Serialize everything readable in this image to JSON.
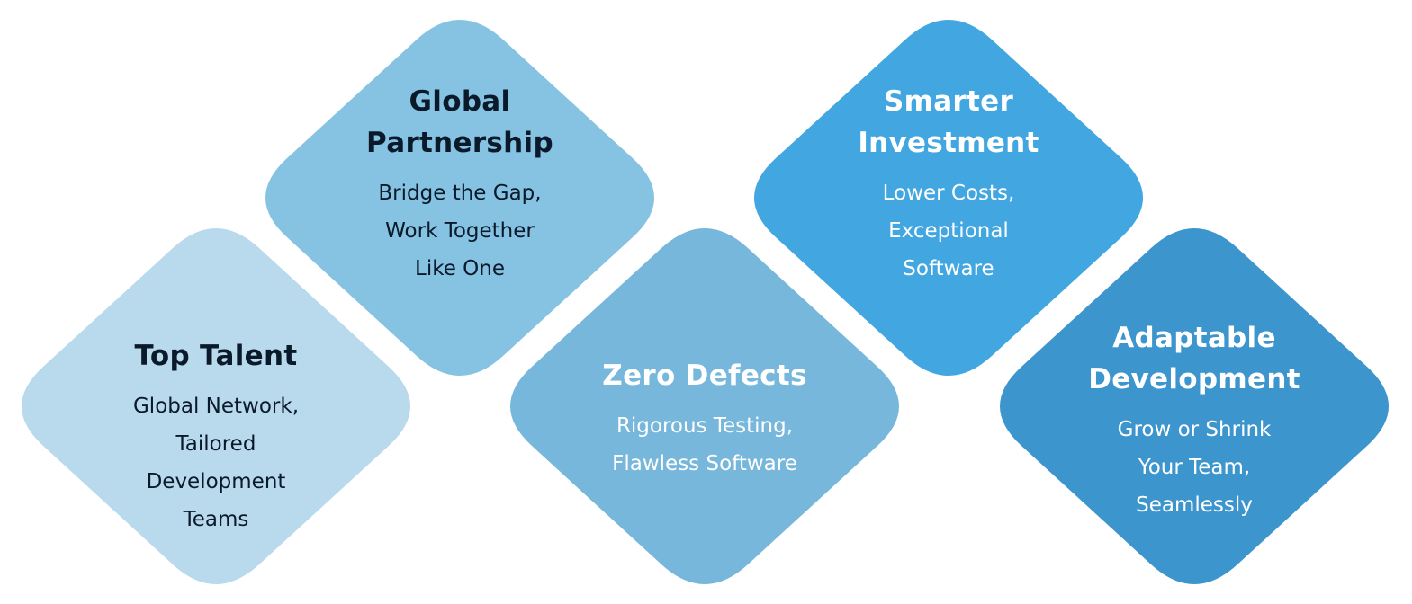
{
  "diamonds": [
    {
      "title": "Top Talent",
      "description_lines": [
        "Global Network,",
        "Tailored",
        "Development",
        "Teams"
      ],
      "fill": "#b9d9ec",
      "text_color": "dark"
    },
    {
      "title": "Global Partnership",
      "title_lines": [
        "Global",
        "Partnership"
      ],
      "description_lines": [
        "Bridge the Gap,",
        "Work Together",
        "Like One"
      ],
      "fill": "#86c3e2",
      "text_color": "dark"
    },
    {
      "title": "Zero Defects",
      "description_lines": [
        "Rigorous Testing,",
        "Flawless Software"
      ],
      "fill": "#76b7db",
      "text_color": "light"
    },
    {
      "title": "Smarter Investment",
      "title_lines": [
        "Smarter",
        "Investment"
      ],
      "description_lines": [
        "Lower Costs,",
        "Exceptional",
        "Software"
      ],
      "fill": "#42a6e0",
      "text_color": "light"
    },
    {
      "title": "Adaptable Development",
      "title_lines": [
        "Adaptable",
        "Development"
      ],
      "description_lines": [
        "Grow or Shrink",
        "Your Team,",
        "Seamlessly"
      ],
      "fill": "#3d95cd",
      "text_color": "light"
    }
  ]
}
